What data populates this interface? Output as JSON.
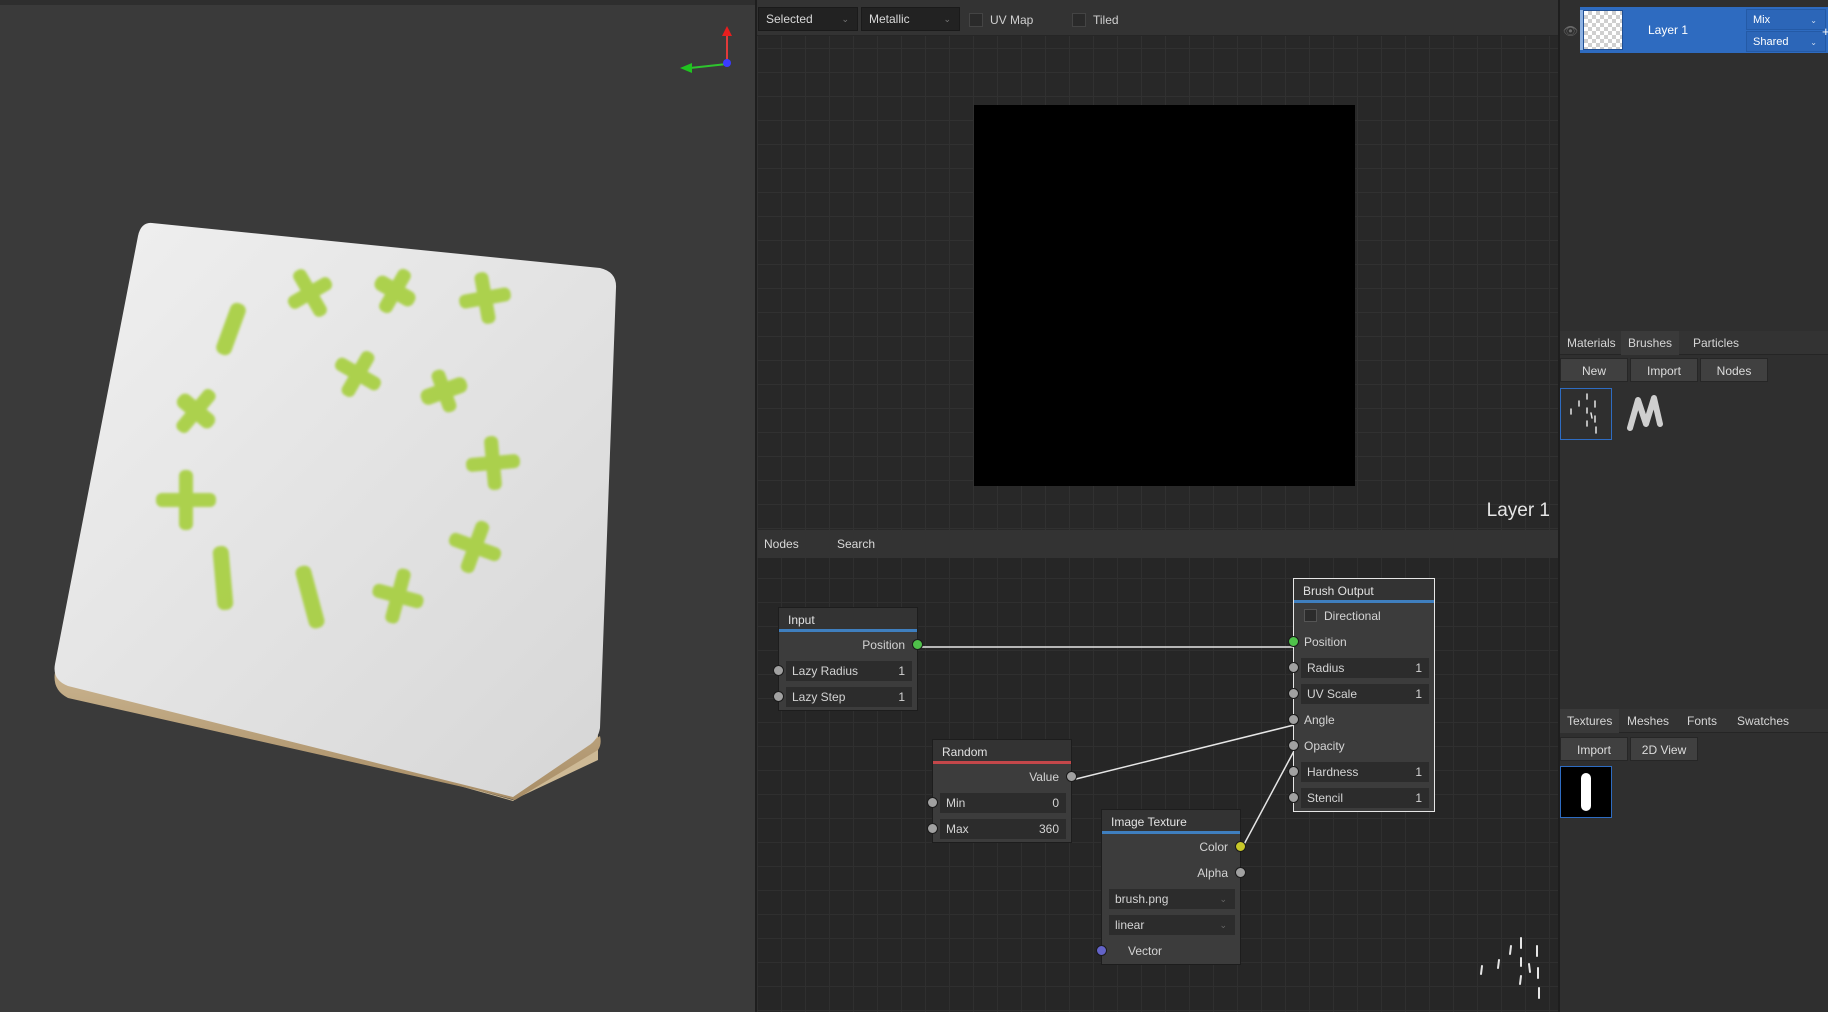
{
  "texture_view": {
    "toolbar": {
      "channel_mode": "Selected",
      "channel": "Metallic",
      "uv_map_label": "UV Map",
      "tiled_label": "Tiled"
    },
    "canvas_label": "Layer 1"
  },
  "node_editor": {
    "tabs": [
      "Nodes",
      "Search"
    ],
    "nodes": {
      "input": {
        "title": "Input",
        "position_label": "Position",
        "lazy_radius_label": "Lazy Radius",
        "lazy_radius_value": "1",
        "lazy_step_label": "Lazy Step",
        "lazy_step_value": "1"
      },
      "random": {
        "title": "Random",
        "value_label": "Value",
        "min_label": "Min",
        "min_value": "0",
        "max_label": "Max",
        "max_value": "360"
      },
      "image_texture": {
        "title": "Image Texture",
        "color_label": "Color",
        "alpha_label": "Alpha",
        "file": "brush.png",
        "interpolation": "linear",
        "vector_label": "Vector"
      },
      "brush_output": {
        "title": "Brush Output",
        "directional_label": "Directional",
        "position_label": "Position",
        "radius_label": "Radius",
        "radius_value": "1",
        "uv_scale_label": "UV Scale",
        "uv_scale_value": "1",
        "angle_label": "Angle",
        "opacity_label": "Opacity",
        "hardness_label": "Hardness",
        "hardness_value": "1",
        "stencil_label": "Stencil",
        "stencil_value": "1"
      }
    },
    "socket_colors": {
      "vector": "#4fc14a",
      "value": "#a1a1a1",
      "color": "#c7c729",
      "vector_in": "#6363c7"
    }
  },
  "layers": {
    "layer_name": "Layer 1",
    "blending": "Mix",
    "object": "Shared",
    "add_label": "+"
  },
  "asset_tabs": {
    "tabs": [
      "Materials",
      "Brushes",
      "Particles"
    ],
    "active": "Brushes",
    "buttons": [
      "New",
      "Import",
      "Nodes"
    ]
  },
  "texture_tabs": {
    "tabs": [
      "Textures",
      "Meshes",
      "Fonts",
      "Swatches"
    ],
    "active": "Textures",
    "buttons": [
      "Import",
      "2D View"
    ]
  },
  "colors": {
    "accent": "#2e6bc0",
    "decal_green": "#a6cf3c",
    "cube_top": "#dcdcdc",
    "cube_side": "#b59b74"
  }
}
